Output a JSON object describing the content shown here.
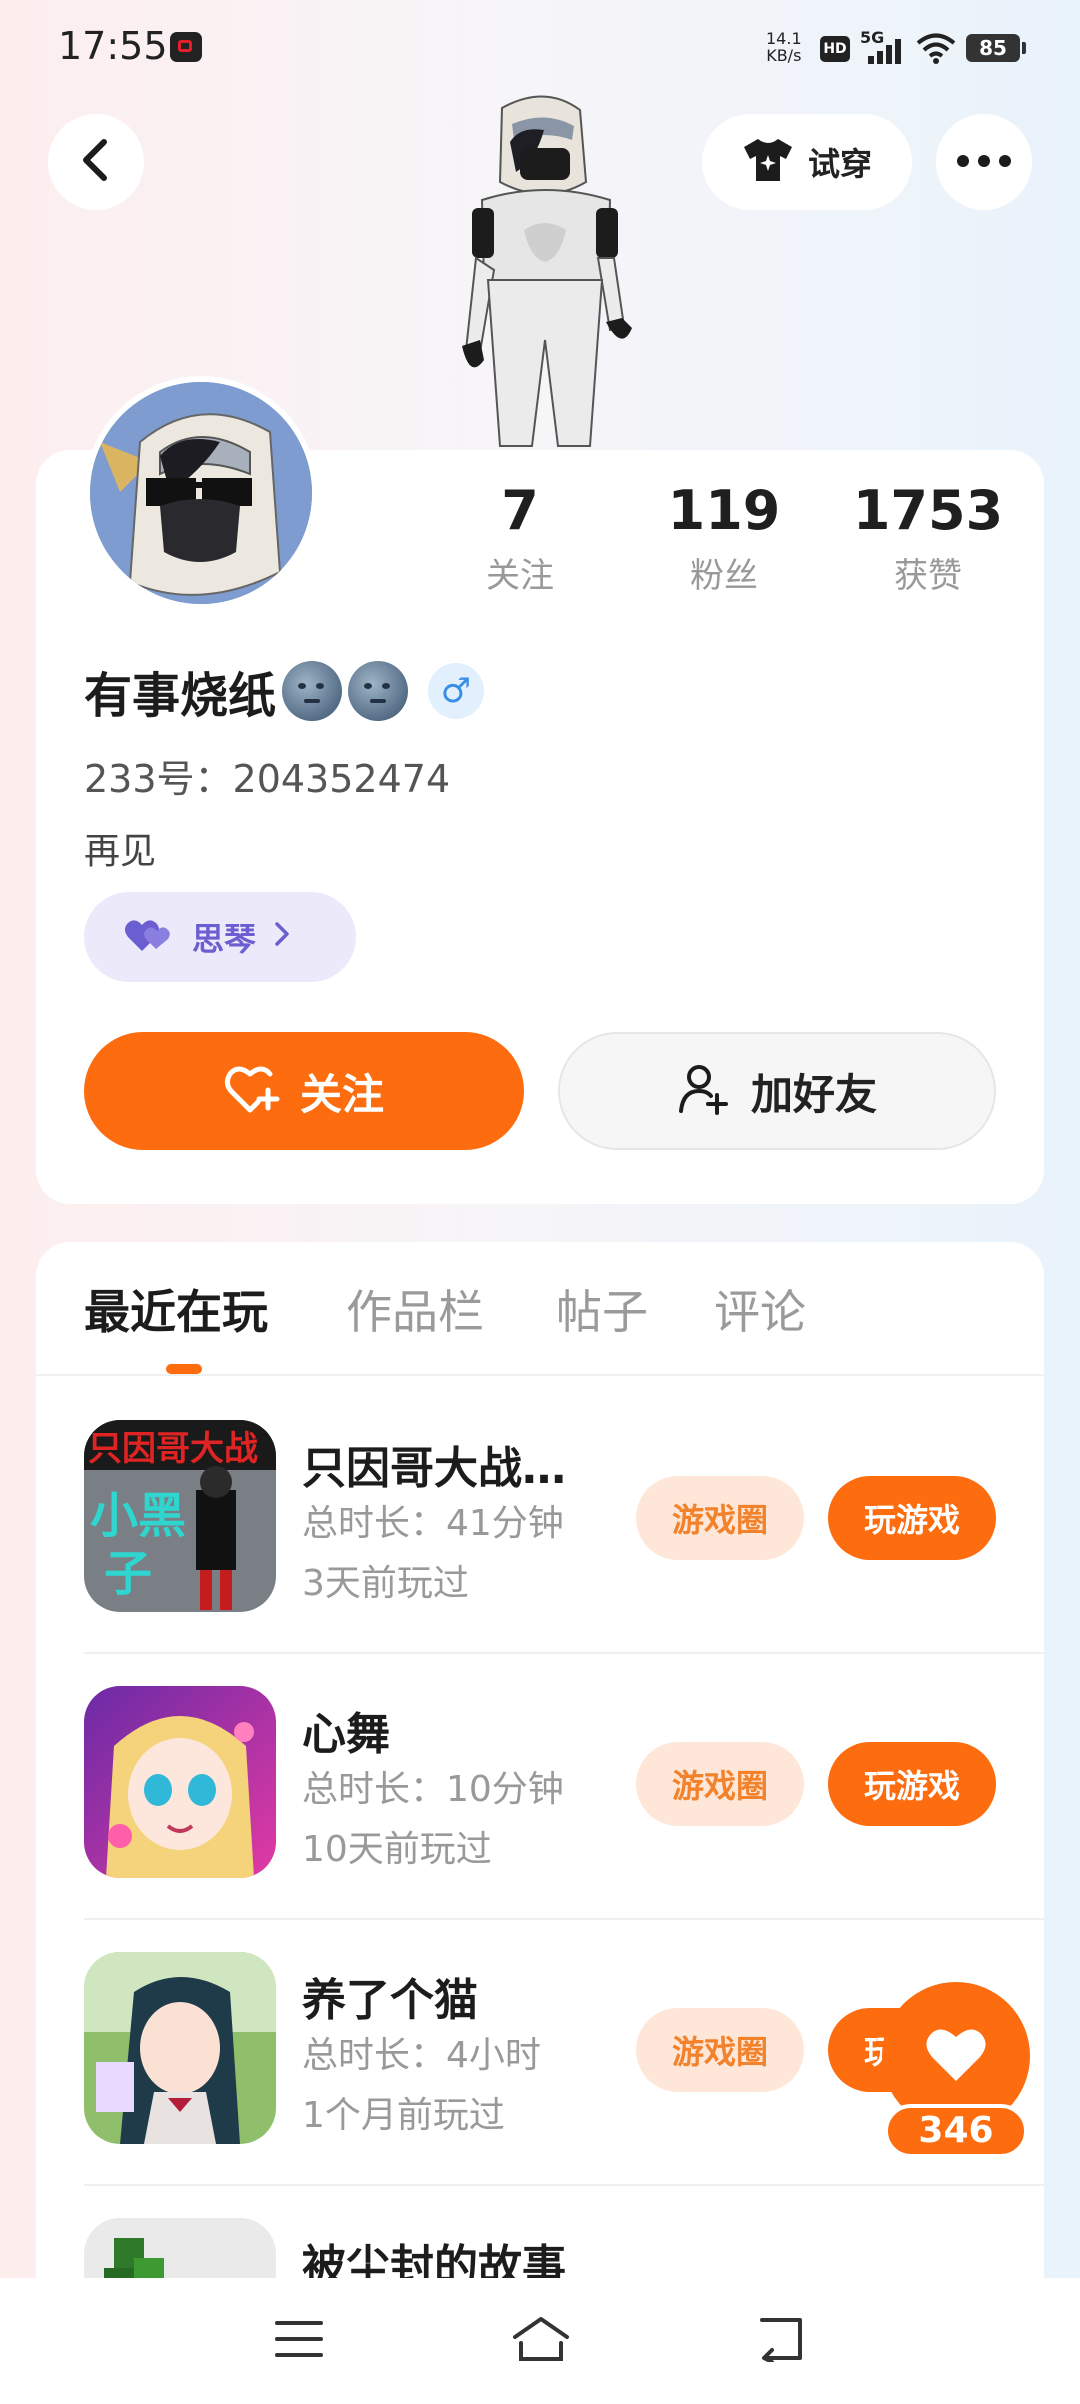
{
  "status_bar": {
    "time": "17:55",
    "net_speed_value": "14.1",
    "net_speed_unit": "KB/s",
    "hd": "HD",
    "network": "5G",
    "battery": "85"
  },
  "header": {
    "tryon_label": "试穿"
  },
  "profile": {
    "stats": [
      {
        "value": "7",
        "label": "关注"
      },
      {
        "value": "119",
        "label": "粉丝"
      },
      {
        "value": "1753",
        "label": "获赞"
      }
    ],
    "username": "有事烧纸",
    "gender_symbol": "♂",
    "user_id": "233号：204352474",
    "bio": "再见",
    "relation_tag": "思琴",
    "follow_label": "关注",
    "add_friend_label": "加好友"
  },
  "tabs": [
    "最近在玩",
    "作品栏",
    "帖子",
    "评论"
  ],
  "games": [
    {
      "title": "只因哥大战…",
      "playtime": "总时长：41分钟",
      "last_played": "3天前玩过",
      "circle_label": "游戏圈",
      "play_label": "玩游戏"
    },
    {
      "title": "心舞",
      "playtime": "总时长：10分钟",
      "last_played": "10天前玩过",
      "circle_label": "游戏圈",
      "play_label": "玩游戏"
    },
    {
      "title": "养了个猫",
      "playtime": "总时长：4小时",
      "last_played": "1个月前玩过",
      "circle_label": "游戏圈",
      "play_label": "玩游戏"
    },
    {
      "title": "被尘封的故事"
    }
  ],
  "like_count": "346",
  "colors": {
    "accent": "#fd6c0e",
    "accent_soft": "#fee7d8",
    "relation": "#6a5ed0"
  }
}
